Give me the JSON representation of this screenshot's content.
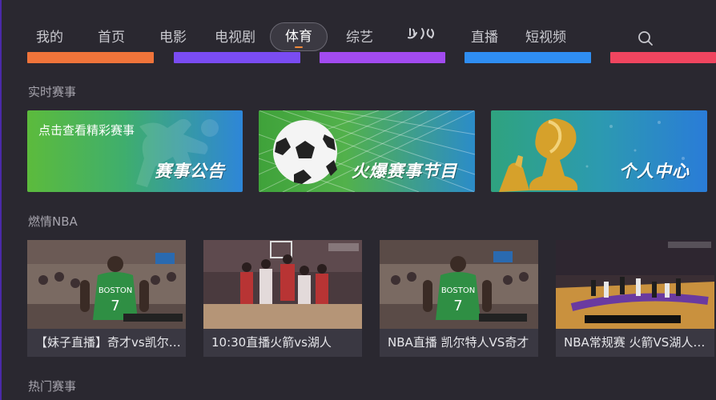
{
  "nav": {
    "items": [
      {
        "label": "我的"
      },
      {
        "label": "首页"
      },
      {
        "label": "电影"
      },
      {
        "label": "电视剧"
      },
      {
        "label": "体育",
        "active": true
      },
      {
        "label": "综艺"
      },
      {
        "label": "少儿",
        "brand_mark": true
      },
      {
        "label": "直播"
      },
      {
        "label": "短视频"
      }
    ],
    "search_icon": "search-icon"
  },
  "color_strips": [
    "#f0743a",
    "#7a4cf2",
    "#a24bf0",
    "#2f8ef2",
    "#f0455f"
  ],
  "sections": {
    "live": "实时赛事",
    "nba": "燃情NBA",
    "hot": "热门赛事"
  },
  "banners": [
    {
      "sub": "点击查看精彩赛事",
      "label": "赛事公告"
    },
    {
      "label": "火爆赛事节目"
    },
    {
      "label": "个人中心"
    }
  ],
  "videos": [
    {
      "caption": "【妹子直播】奇才vs凯尔特人"
    },
    {
      "caption": "10:30直播火箭vs湖人"
    },
    {
      "caption": "NBA直播 凯尔特人VS奇才"
    },
    {
      "caption": "NBA常规赛 火箭VS湖人第四节"
    }
  ],
  "video_thumb_text": {
    "jersey_team": "BOSTON",
    "jersey_number": "7"
  }
}
